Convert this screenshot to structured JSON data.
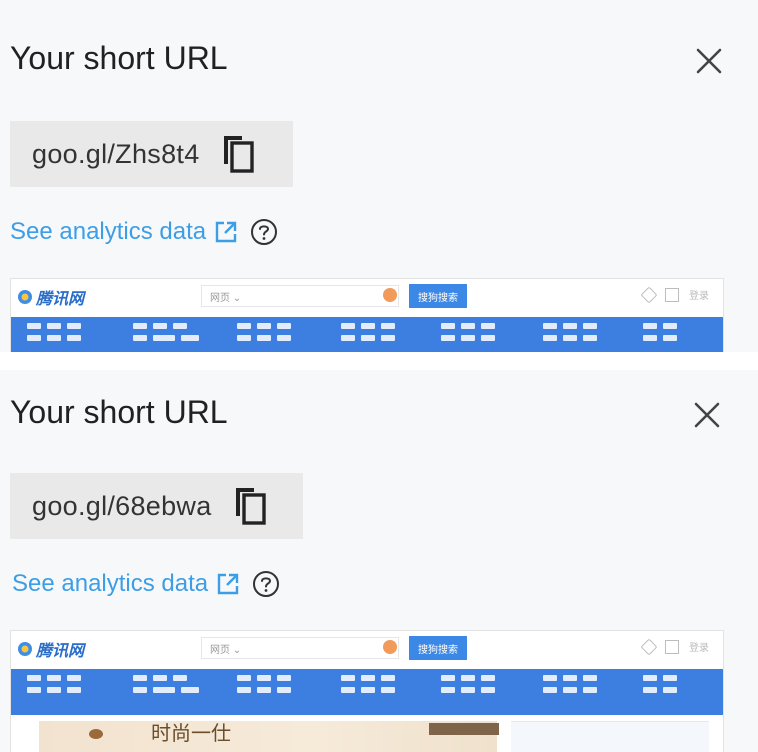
{
  "panels": [
    {
      "title": "Your short URL",
      "short_url": "goo.gl/Zhs8t4",
      "analytics_link": "See analytics data",
      "preview": {
        "logo_text": "腾讯网",
        "search_dropdown": "网页 ⌄",
        "search_button": "搜狗搜索",
        "login_text": "登录"
      }
    },
    {
      "title": "Your short URL",
      "short_url": "goo.gl/68ebwa",
      "analytics_link": "See analytics data",
      "preview": {
        "logo_text": "腾讯网",
        "search_dropdown": "网页 ⌄",
        "search_button": "搜狗搜索",
        "login_text": "登录",
        "banner_text": "时尚一仕"
      }
    }
  ],
  "colors": {
    "panel_bg": "#f7f8f9",
    "url_box_bg": "#e9e9ea",
    "link": "#3c9ee6",
    "preview_nav": "#3c7fe0",
    "preview_button": "#3c88e6"
  },
  "icons": [
    "close-icon",
    "copy-icon",
    "external-link-icon",
    "help-icon"
  ]
}
